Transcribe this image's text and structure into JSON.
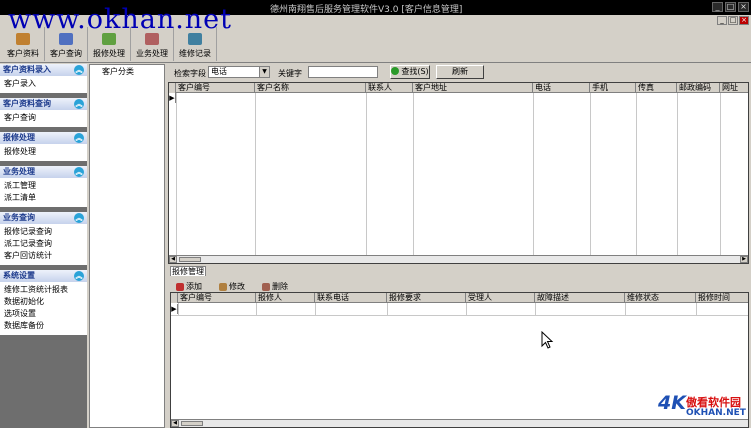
{
  "window": {
    "title": "德州南翔售后服务管理软件V3.0 [客户信息管理]",
    "controls": [
      "_",
      "□",
      "×"
    ],
    "mdi_controls": [
      "_",
      "□",
      "×"
    ]
  },
  "watermark": "www.okhan.net",
  "toolbar": {
    "buttons": [
      {
        "label": "客户资料",
        "icon": "person-card-icon",
        "color": "#c08030"
      },
      {
        "label": "客户查询",
        "icon": "search-person-icon",
        "color": "#5070c0"
      },
      {
        "label": "报修处理",
        "icon": "tools-icon",
        "color": "#60a040"
      },
      {
        "label": "业务处理",
        "icon": "briefcase-icon",
        "color": "#b06060"
      },
      {
        "label": "维修记录",
        "icon": "record-book-icon",
        "color": "#4080a0"
      }
    ]
  },
  "sidebar": {
    "groups": [
      {
        "title": "客户资料录入",
        "items": [
          "客户录入"
        ]
      },
      {
        "title": "客户资料查询",
        "items": [
          "客户查询"
        ]
      },
      {
        "title": "报修处理",
        "items": [
          "报修处理"
        ]
      },
      {
        "title": "业务处理",
        "items": [
          "派工管理",
          "派工清单"
        ]
      },
      {
        "title": "业务查询",
        "items": [
          "报修记录查询",
          "派工记录查询",
          "客户回访统计"
        ]
      },
      {
        "title": "系统设置",
        "items": [
          "维修工资统计报表",
          "数据初始化",
          "选项设置",
          "数据库备份"
        ]
      }
    ]
  },
  "tree": {
    "root": "客户分类"
  },
  "query": {
    "field_label": "检索字段",
    "field_value": "电话",
    "keyword_label": "关键字",
    "keyword_value": "",
    "search_button": "查找(S)",
    "refresh_button": "刷新"
  },
  "customer_grid": {
    "columns": [
      "客户编号",
      "客户名称",
      "联系人",
      "客户地址",
      "电话",
      "手机",
      "传真",
      "邮政编码",
      "网址"
    ],
    "rows": []
  },
  "lower_panel": {
    "tab": "报修管理",
    "actions": [
      "添加",
      "修改",
      "删除"
    ],
    "columns": [
      "客户编号",
      "报修人",
      "联系电话",
      "报修要求",
      "受理人",
      "故障描述",
      "维修状态",
      "报修时间"
    ],
    "rows": []
  },
  "logo": {
    "mark": "4K",
    "cn": "傲看软件园",
    "en": "OKHAN.NET"
  }
}
